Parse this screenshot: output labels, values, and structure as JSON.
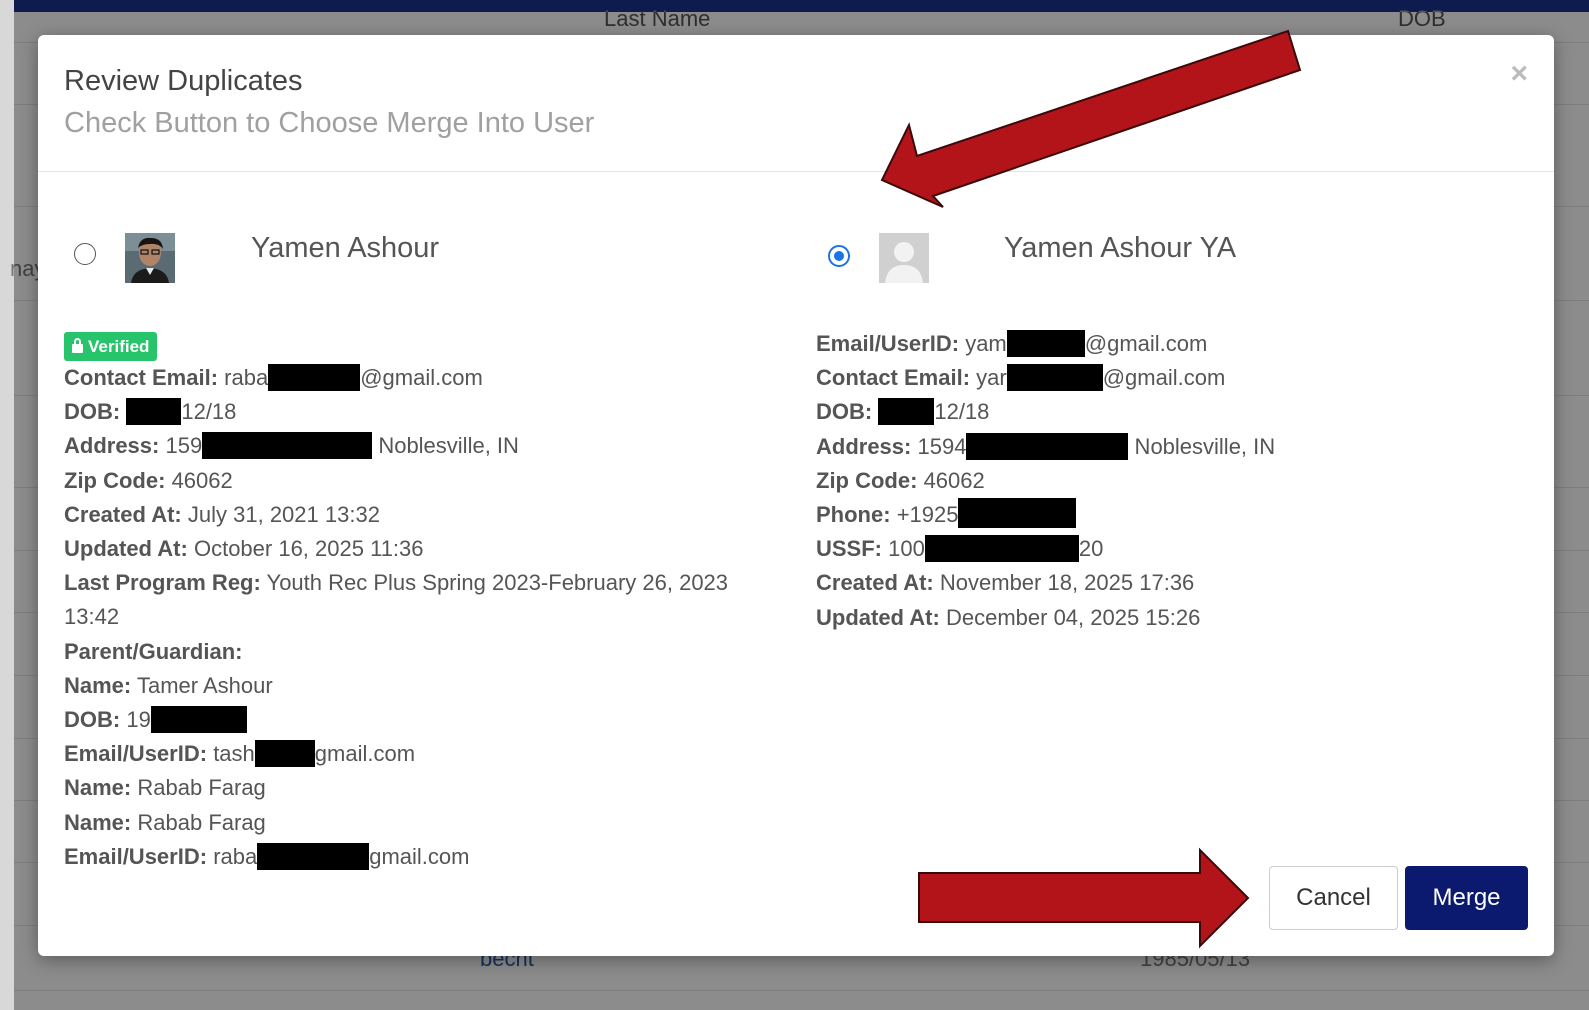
{
  "background": {
    "header_last_name": "Last Name",
    "header_dob": "DOB",
    "left_fragment": "nay",
    "bottom_link": "becht",
    "bottom_date": "1985/05/13"
  },
  "modal": {
    "title": "Review Duplicates",
    "subtitle": "Check Button to Choose Merge Into User",
    "close_symbol": "×",
    "cancel_label": "Cancel",
    "merge_label": "Merge"
  },
  "left_user": {
    "name": "Yamen Ashour",
    "selected": false,
    "verified_label": "Verified",
    "contact_email": {
      "label": "Contact Email:",
      "prefix": "raba",
      "suffix": "@gmail.com"
    },
    "dob": {
      "label": "DOB:",
      "prefix": "",
      "suffix": "12/18"
    },
    "address": {
      "label": "Address:",
      "prefix": "159",
      "suffix": " Noblesville, IN"
    },
    "zip": {
      "label": "Zip Code:",
      "value": "46062"
    },
    "created": {
      "label": "Created At:",
      "value": "July 31, 2021 13:32"
    },
    "updated": {
      "label": "Updated At:",
      "value": "October 16, 2025 11:36"
    },
    "last_program": {
      "label": "Last Program Reg:",
      "value": "Youth Rec Plus Spring 2023-February 26, 2023 13:42"
    },
    "parent_header": "Parent/Guardian:",
    "parent1_name": {
      "label": "Name:",
      "value": "Tamer Ashour"
    },
    "parent1_dob": {
      "label": "DOB:",
      "prefix": "19"
    },
    "parent1_email": {
      "label": "Email/UserID:",
      "prefix": "tash",
      "suffix": "gmail.com"
    },
    "parent2_name": {
      "label": "Name:",
      "value": "Rabab Farag"
    },
    "parent3_name": {
      "label": "Name:",
      "value": "Rabab Farag"
    },
    "parent3_email": {
      "label": "Email/UserID:",
      "prefix": "raba",
      "suffix": "gmail.com"
    }
  },
  "right_user": {
    "name": "Yamen Ashour YA",
    "selected": true,
    "email_userid": {
      "label": "Email/UserID:",
      "prefix": "yam",
      "suffix": "@gmail.com"
    },
    "contact_email": {
      "label": "Contact Email:",
      "prefix": "yar",
      "suffix": "@gmail.com"
    },
    "dob": {
      "label": "DOB:",
      "suffix": "12/18"
    },
    "address": {
      "label": "Address:",
      "prefix": "1594",
      "suffix": " Noblesville, IN"
    },
    "zip": {
      "label": "Zip Code:",
      "value": "46062"
    },
    "phone": {
      "label": "Phone:",
      "prefix": "+1925"
    },
    "ussf": {
      "label": "USSF:",
      "prefix": "100",
      "suffix": "20"
    },
    "created": {
      "label": "Created At:",
      "value": "November 18, 2025 17:36"
    },
    "updated": {
      "label": "Updated At:",
      "value": "December 04, 2025 15:26"
    }
  },
  "colors": {
    "primary_button": "#0b1a6e",
    "verified_green": "#27c46b",
    "radio_blue": "#1a73e8",
    "arrow_red": "#b3141a"
  }
}
